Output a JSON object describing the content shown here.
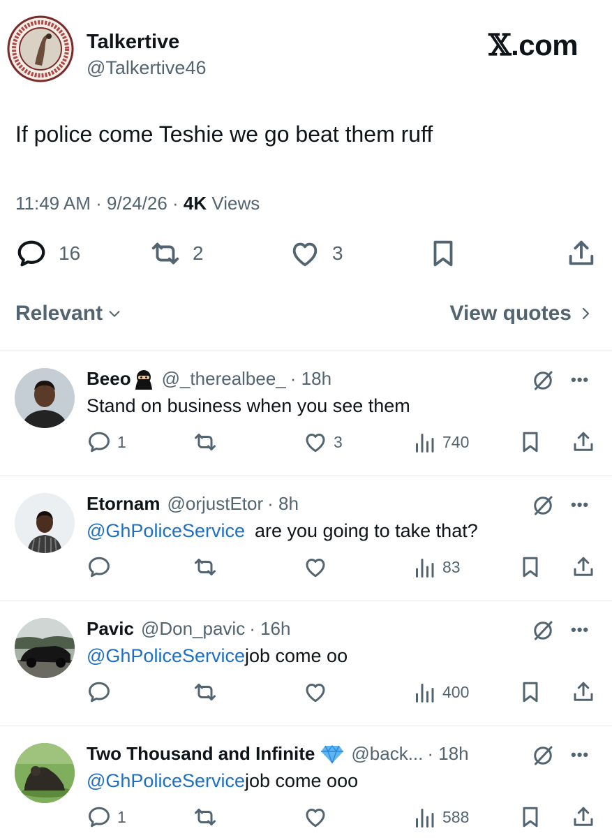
{
  "brand": {
    "prefix": "𝕏",
    "suffix": ".com"
  },
  "post": {
    "author_name": "Talkertive",
    "author_handle": "@Talkertive46",
    "text": "If police come Teshie we go beat them ruff",
    "time": "11:49 AM · 9/24/26 · ",
    "views_count": "4K",
    "views_label": " Views",
    "replies": "16",
    "reposts": "2",
    "likes": "3"
  },
  "filters": {
    "sort": "Relevant",
    "view_quotes": "View quotes"
  },
  "replies": [
    {
      "name": "Beeo",
      "handle": "@_therealbee_",
      "time": "· 18h",
      "mention": "",
      "text": "Stand on business when you see them",
      "reply_count": "1",
      "likes": "3",
      "views": "740"
    },
    {
      "name": "Etornam",
      "handle": "@orjustEtor",
      "time": "· 8h",
      "mention": "@GhPoliceService",
      "text": "are you going to take that?",
      "reply_count": "",
      "likes": "",
      "views": "83"
    },
    {
      "name": "Pavic",
      "handle": "@Don_pavic",
      "time": "· 16h",
      "mention": "@GhPoliceService",
      "text": "job come oo",
      "reply_count": "",
      "likes": "",
      "views": "400"
    },
    {
      "name": "Two Thousand and Infinite",
      "handle": "@back...",
      "time": "· 18h",
      "mention": "@GhPoliceService",
      "text": "job come ooo",
      "reply_count": "1",
      "likes": "",
      "views": "588"
    }
  ],
  "colors": {
    "text": "#0f1419",
    "muted": "#536471",
    "link": "#1d6fc4",
    "divider": "#e6e9eb",
    "verified_gem": "#4aa8f0"
  },
  "icons": [
    "logo-avatar",
    "reply-icon",
    "repost-icon",
    "like-icon",
    "bookmark-icon",
    "share-icon",
    "views-icon",
    "grok-icon",
    "more-icon",
    "ninja-emoji",
    "diamond-emoji",
    "chevron-down-icon",
    "chevron-right-icon"
  ]
}
